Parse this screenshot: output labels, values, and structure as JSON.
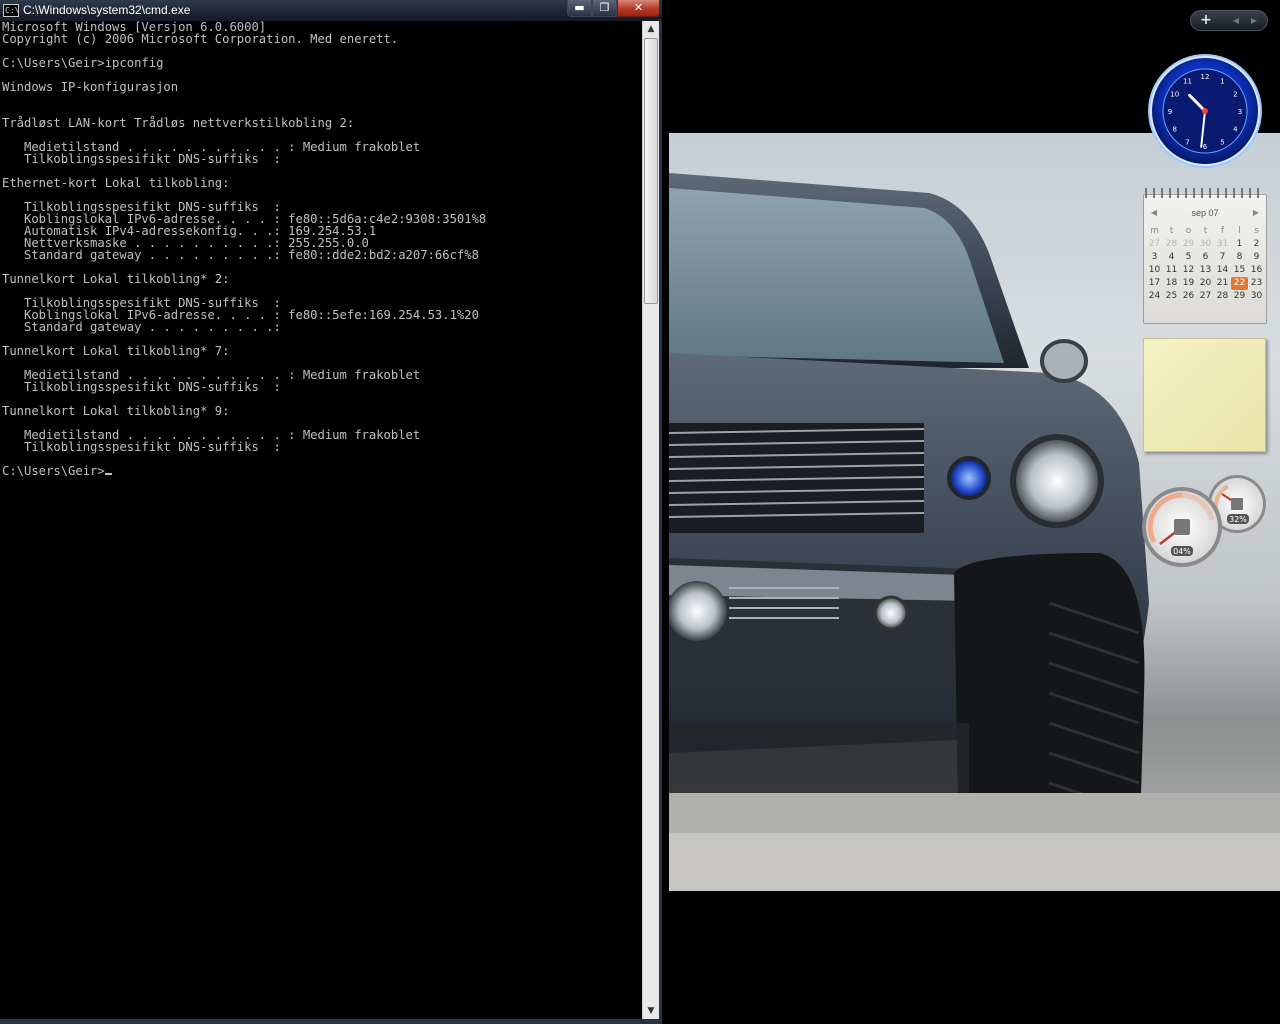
{
  "window": {
    "title": "C:\\Windows\\system32\\cmd.exe",
    "icon_text": "C:\\",
    "buttons": {
      "minimize": "▬",
      "maximize": "❐",
      "close": "✕"
    }
  },
  "console_lines": [
    "Microsoft Windows [Versjon 6.0.6000]",
    "Copyright (c) 2006 Microsoft Corporation. Med enerett.",
    "",
    "C:\\Users\\Geir>ipconfig",
    "",
    "Windows IP-konfigurasjon",
    "",
    "",
    "Trådløst LAN-kort Trådløs nettverkstilkobling 2:",
    "",
    "   Medietilstand . . . . . . . . . . . : Medium frakoblet",
    "   Tilkoblingsspesifikt DNS-suffiks  :",
    "",
    "Ethernet-kort Lokal tilkobling:",
    "",
    "   Tilkoblingsspesifikt DNS-suffiks  :",
    "   Koblingslokal IPv6-adresse. . . . : fe80::5d6a:c4e2:9308:3501%8",
    "   Automatisk IPv4-adressekonfig. . .: 169.254.53.1",
    "   Nettverksmaske . . . . . . . . . .: 255.255.0.0",
    "   Standard gateway . . . . . . . . .: fe80::dde2:bd2:a207:66cf%8",
    "",
    "Tunnelkort Lokal tilkobling* 2:",
    "",
    "   Tilkoblingsspesifikt DNS-suffiks  :",
    "   Koblingslokal IPv6-adresse. . . . : fe80::5efe:169.254.53.1%20",
    "   Standard gateway . . . . . . . . .:",
    "",
    "Tunnelkort Lokal tilkobling* 7:",
    "",
    "   Medietilstand . . . . . . . . . . . : Medium frakoblet",
    "   Tilkoblingsspesifikt DNS-suffiks  :",
    "",
    "Tunnelkort Lokal tilkobling* 9:",
    "",
    "   Medietilstand . . . . . . . . . . . : Medium frakoblet",
    "   Tilkoblingsspesifikt DNS-suffiks  :",
    ""
  ],
  "prompt": "C:\\Users\\Geir>",
  "scrollbar": {
    "up": "▲",
    "down": "▼"
  },
  "sidebar": {
    "controls": {
      "add": "+",
      "prev": "◀",
      "next": "▶"
    },
    "clock": {
      "numbers": [
        "12",
        "1",
        "2",
        "3",
        "4",
        "5",
        "6",
        "7",
        "8",
        "9",
        "10",
        "11"
      ],
      "hour": 10,
      "minute": 31
    },
    "calendar": {
      "month": "sep 07",
      "prev": "◀",
      "next": "▶",
      "weekdays": [
        "m",
        "t",
        "o",
        "t",
        "f",
        "l",
        "s"
      ],
      "weeks": [
        [
          {
            "d": "27",
            "o": true
          },
          {
            "d": "28",
            "o": true
          },
          {
            "d": "29",
            "o": true
          },
          {
            "d": "30",
            "o": true
          },
          {
            "d": "31",
            "o": true
          },
          {
            "d": "1"
          },
          {
            "d": "2"
          }
        ],
        [
          {
            "d": "3"
          },
          {
            "d": "4"
          },
          {
            "d": "5"
          },
          {
            "d": "6"
          },
          {
            "d": "7"
          },
          {
            "d": "8"
          },
          {
            "d": "9"
          }
        ],
        [
          {
            "d": "10"
          },
          {
            "d": "11"
          },
          {
            "d": "12"
          },
          {
            "d": "13"
          },
          {
            "d": "14"
          },
          {
            "d": "15"
          },
          {
            "d": "16"
          }
        ],
        [
          {
            "d": "17"
          },
          {
            "d": "18"
          },
          {
            "d": "19"
          },
          {
            "d": "20"
          },
          {
            "d": "21"
          },
          {
            "d": "22",
            "t": true
          },
          {
            "d": "23"
          }
        ],
        [
          {
            "d": "24"
          },
          {
            "d": "25"
          },
          {
            "d": "26"
          },
          {
            "d": "27"
          },
          {
            "d": "28"
          },
          {
            "d": "29"
          },
          {
            "d": "30"
          }
        ]
      ]
    },
    "meters": {
      "cpu": "04%",
      "memory": "32%"
    }
  }
}
